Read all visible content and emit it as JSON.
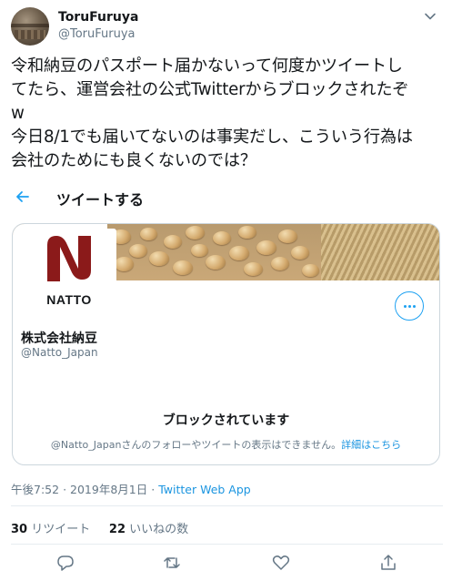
{
  "author": {
    "name": "ToruFuruya",
    "handle": "@ToruFuruya",
    "avatar_icon": "avatar-photo",
    "menu_icon": "chevron-down-icon"
  },
  "tweet": {
    "lines": [
      "令和納豆のパスポート届かないって何度かツイートし",
      "てたら、運営会社の公式Twitterからブロックされたぞ",
      "w",
      "今日8/1でも届いてないのは事実だし、こういう行為は",
      "会社のためにも良くないのでは？"
    ]
  },
  "quoted_action": {
    "back_icon": "back-arrow-icon",
    "label": "ツイートする"
  },
  "card": {
    "logo_text": "NATTO",
    "company_name": "株式会社納豆",
    "company_handle": "@Natto_Japan",
    "blocked_title": "ブロックされています",
    "blocked_desc": "@Natto_Japanさんのフォローやツイートの表示はできません。",
    "blocked_link": "詳細はこちら",
    "more_icon": "more-options-icon",
    "logo_color": "#8b1a1a"
  },
  "meta": {
    "time": "午後7:52",
    "date": "2019年8月1日",
    "separator": "·",
    "app": "Twitter Web App"
  },
  "stats": {
    "retweets_count": "30",
    "retweets_label": "リツイート",
    "likes_count": "22",
    "likes_label": "いいねの数"
  },
  "actions": [
    "reply-icon",
    "retweet-icon",
    "like-icon",
    "share-icon"
  ],
  "colors": {
    "accent": "#1da1f2",
    "text": "#14171a",
    "secondary": "#657786",
    "border": "#ccd6dd"
  }
}
